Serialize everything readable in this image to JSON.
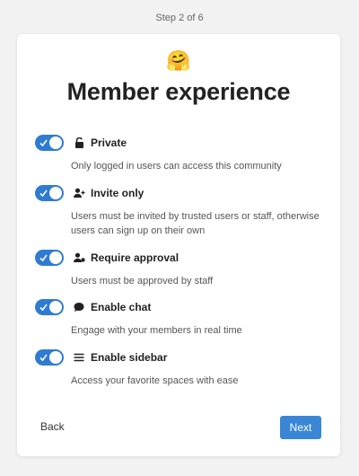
{
  "header": {
    "step_text": "Step 2 of 6"
  },
  "card": {
    "emoji": "🤗",
    "title": "Member experience",
    "options": [
      {
        "icon": "lock-icon",
        "label": "Private",
        "description": "Only logged in users can access this community",
        "enabled": true
      },
      {
        "icon": "user-plus-icon",
        "label": "Invite only",
        "description": "Users must be invited by trusted users or staff, otherwise users can sign up on their own",
        "enabled": true
      },
      {
        "icon": "user-check-icon",
        "label": "Require approval",
        "description": "Users must be approved by staff",
        "enabled": true
      },
      {
        "icon": "chat-bubble-icon",
        "label": "Enable chat",
        "description": "Engage with your members in real time",
        "enabled": true
      },
      {
        "icon": "hamburger-icon",
        "label": "Enable sidebar",
        "description": "Access your favorite spaces with ease",
        "enabled": true
      }
    ]
  },
  "footer": {
    "back_label": "Back",
    "next_label": "Next"
  },
  "colors": {
    "toggle_on": "#2e7bd1",
    "primary_button": "#3a86d6"
  }
}
